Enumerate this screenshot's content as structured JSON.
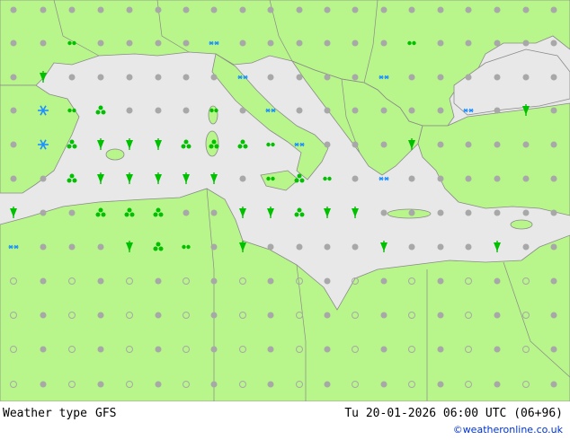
{
  "footer": {
    "title": "Weather type",
    "model": "GFS",
    "valid_time": "Tu 20-01-2026 06:00 UTC (06+96)",
    "credit": "©weatheronline.co.uk"
  },
  "colors": {
    "land": "#b8f58a",
    "sea": "#e8e8e8",
    "border": "#8a8a8a",
    "rain": "#00c000",
    "snow": "#1e90ff",
    "dry": "#a8a8a8"
  },
  "legend_icons": [
    "rain-icon",
    "showers-icon",
    "drizzle-icon",
    "snow-icon",
    "snow-showers-icon",
    "cloudy-dot-icon",
    "partly-cloudy-icon",
    "clear-icon"
  ]
}
